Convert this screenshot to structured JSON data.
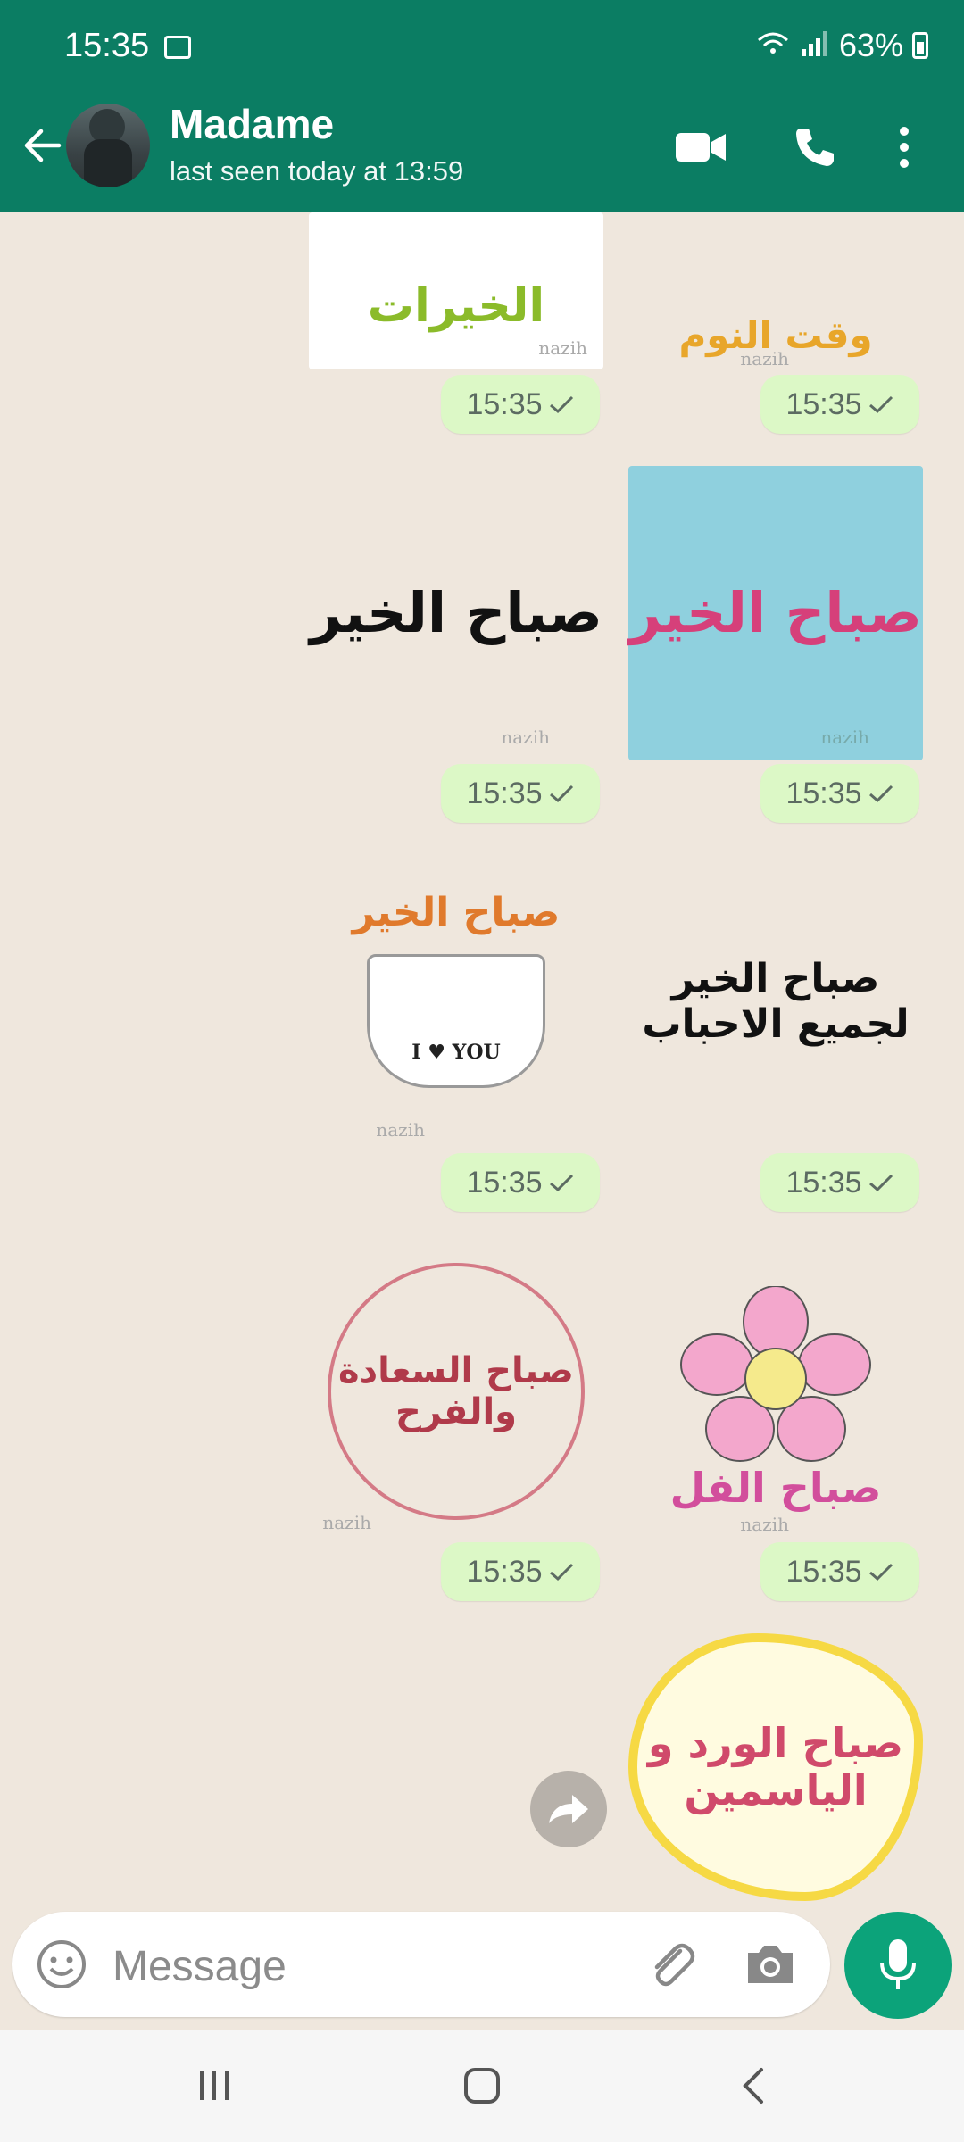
{
  "status_bar": {
    "time": "15:35",
    "battery": "63%"
  },
  "header": {
    "contact_name": "Madame",
    "last_seen": "last seen today at 13:59",
    "accent_color": "#0b7d63"
  },
  "messages": [
    {
      "sticker_text": "الخيرات",
      "watermark": "nazih",
      "time": "15:35"
    },
    {
      "sticker_text": "وقت النوم",
      "watermark": "nazih",
      "time": "15:35"
    },
    {
      "sticker_text": "صباح الخير",
      "watermark": "nazih",
      "time": "15:35"
    },
    {
      "sticker_text": "صباح الخير",
      "watermark": "nazih",
      "time": "15:35"
    },
    {
      "sticker_text": "صباح الخير",
      "watermark": "nazih",
      "time": "15:35"
    },
    {
      "sticker_text": "صباح الخير لجميع الاحباب",
      "watermark": "",
      "time": "15:35"
    },
    {
      "sticker_text": "صباح السعادة والفرح",
      "watermark": "nazih",
      "time": "15:35"
    },
    {
      "sticker_text": "صباح الفل",
      "watermark": "nazih",
      "time": "15:35"
    },
    {
      "sticker_text": "صباح الورد و الياسمين",
      "watermark": "",
      "time": ""
    }
  ],
  "sticker_badge": "I ♥ YOU",
  "composer": {
    "placeholder": "Message"
  },
  "icons": {
    "back": "arrow-left-icon",
    "video": "video-camera-icon",
    "call": "phone-icon",
    "menu": "more-vertical-icon",
    "emoji": "smiley-icon",
    "attach": "paperclip-icon",
    "camera": "camera-icon",
    "mic": "microphone-icon",
    "forward": "forward-arrow-icon"
  }
}
